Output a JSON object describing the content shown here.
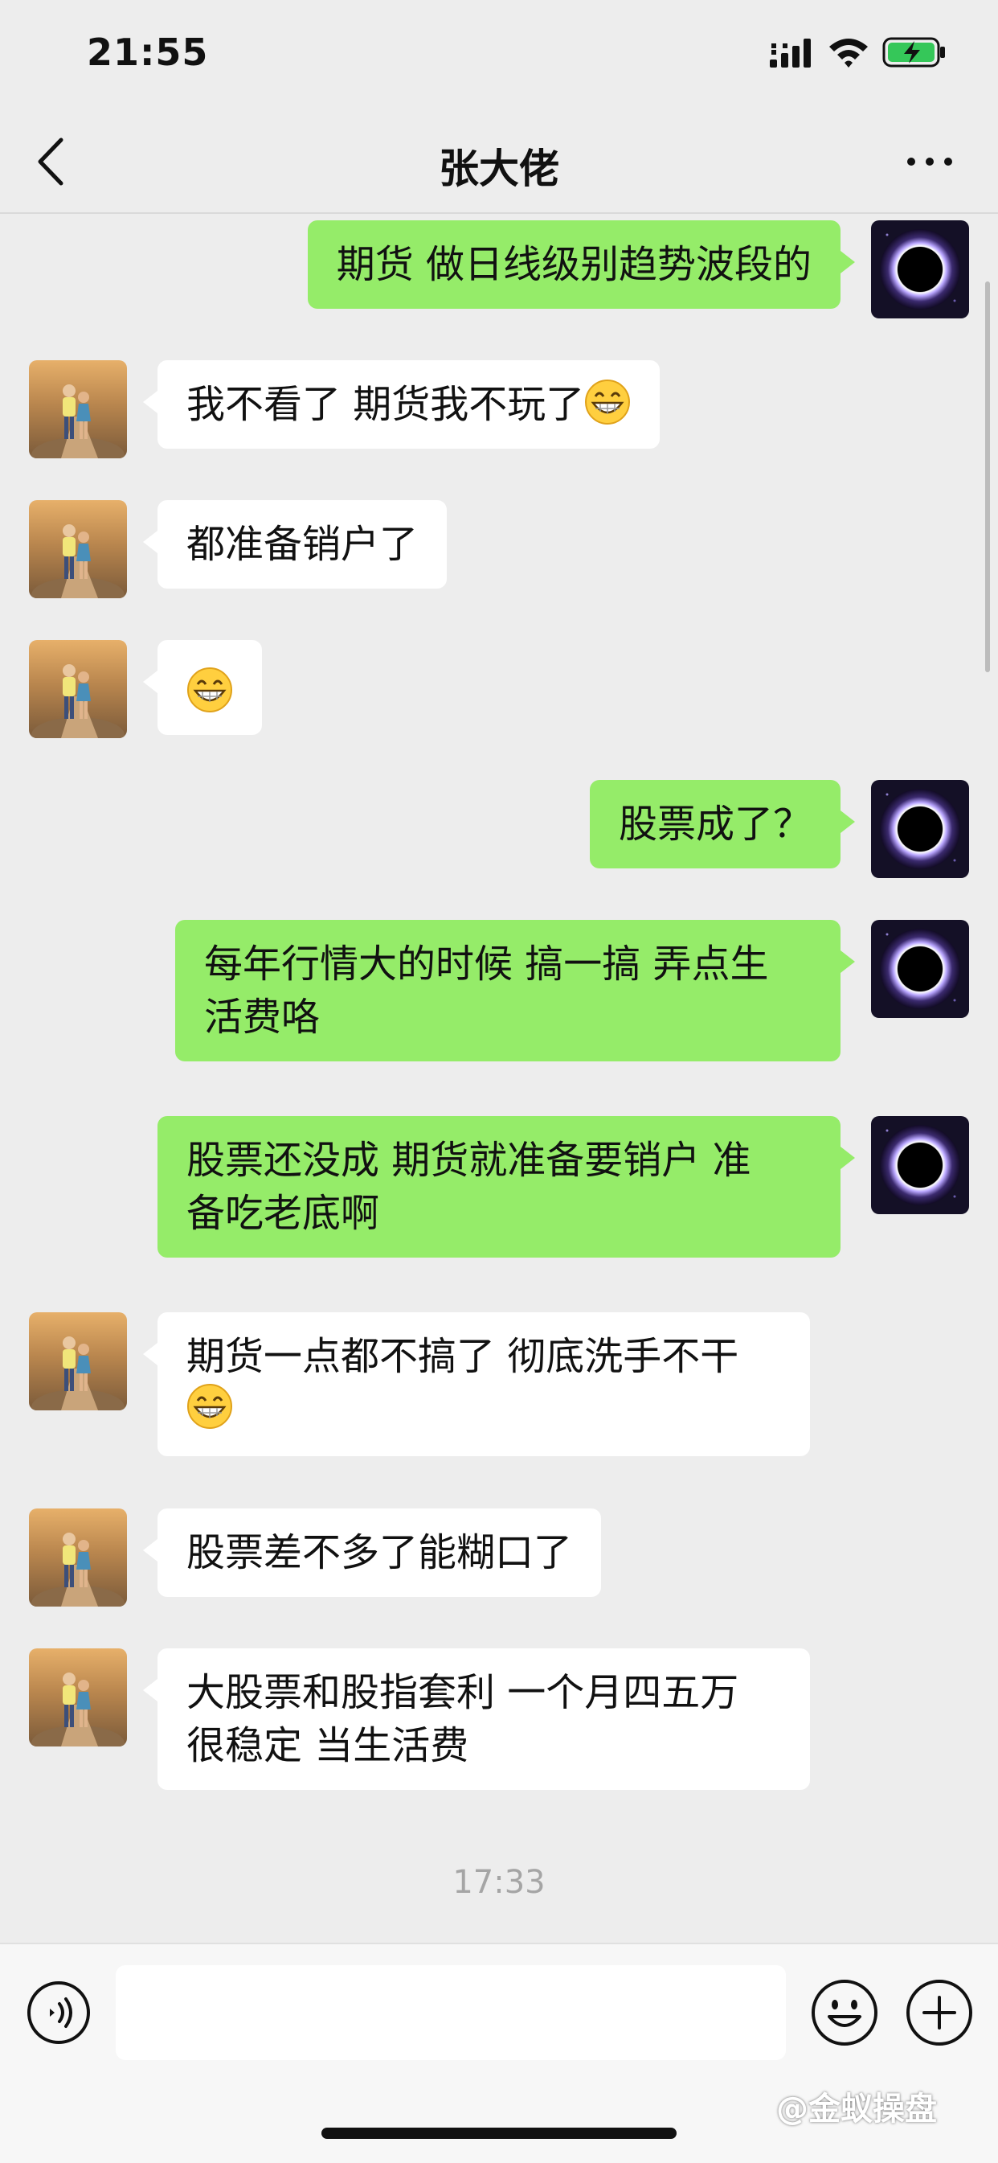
{
  "status_bar": {
    "time": "21:55"
  },
  "header": {
    "title": "张大佬"
  },
  "messages": [
    {
      "side": "out",
      "text": "期货 做日线级别趋势波段的"
    },
    {
      "side": "in",
      "text": "我不看了  期货我不玩了"
    },
    {
      "side": "in",
      "text": "都准备销户了"
    },
    {
      "side": "in",
      "text": ""
    },
    {
      "side": "out",
      "text": "股票成了？"
    },
    {
      "side": "out",
      "line1": "每年行情大的时候 搞一搞 弄点生",
      "line2": "活费咯"
    },
    {
      "side": "out",
      "line1": "股票还没成  期货就准备要销户  准",
      "line2": "备吃老底啊"
    },
    {
      "side": "in",
      "text": "期货一点都不搞了 彻底洗手不干"
    },
    {
      "side": "in",
      "text": "股票差不多了能糊口了"
    },
    {
      "side": "in",
      "line1": "大股票和股指套利  一个月四五万",
      "line2": "很稳定 当生活费"
    }
  ],
  "timestamp": "17:33",
  "input": {
    "placeholder": ""
  },
  "watermark": "@金蚁操盘",
  "colors": {
    "background": "#ededed",
    "outgoing_bubble": "#95ec69",
    "incoming_bubble": "#ffffff"
  },
  "icons": {
    "back": "chevron-left-icon",
    "more": "more-dots-icon",
    "voice": "voice-icon",
    "emoji": "emoji-icon",
    "plus": "plus-icon",
    "grin": "grin-emoji"
  }
}
